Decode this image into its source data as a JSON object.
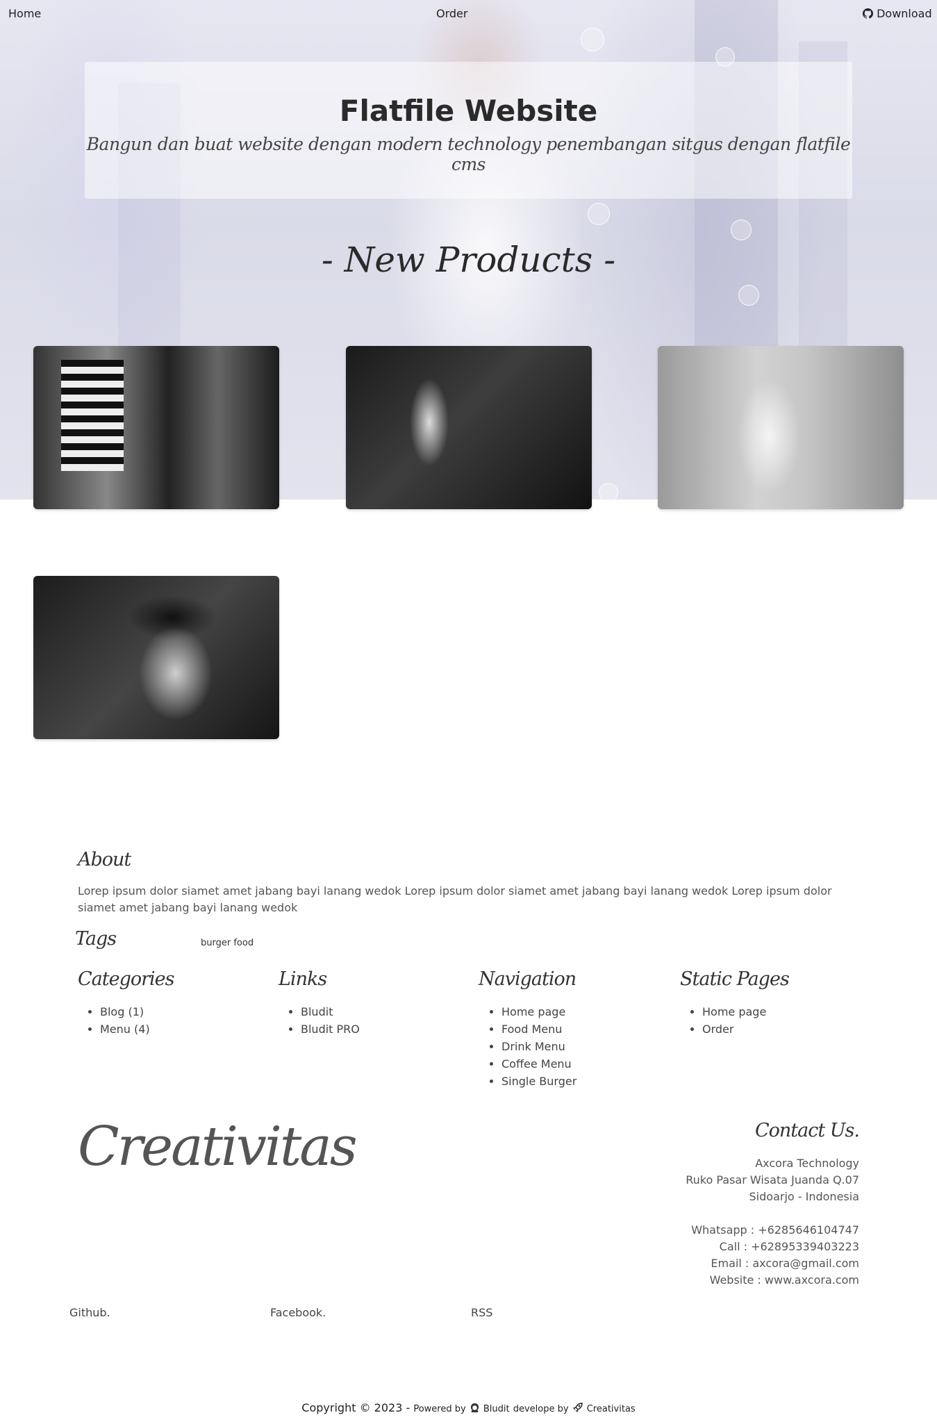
{
  "nav": {
    "home": "Home",
    "order": "Order",
    "download": "Download"
  },
  "banner": {
    "title": "Flatfile Website",
    "subtitle": "Bangun dan buat website dengan modern technology penembangan sitgus dengan flatfile cms"
  },
  "section": {
    "title": "- New Products -"
  },
  "products": [
    {
      "icon": "product-photo-striped-hoodie"
    },
    {
      "icon": "product-photo-dark-seat"
    },
    {
      "icon": "product-photo-sunglasses-street"
    },
    {
      "icon": "product-photo-black-cap"
    }
  ],
  "about": {
    "heading": "About",
    "text": "Lorep ipsum dolor siamet amet jabang bayi lanang wedok Lorep ipsum dolor siamet amet jabang bayi lanang wedok Lorep ipsum dolor siamet amet jabang bayi lanang wedok"
  },
  "tags": {
    "heading": "Tags",
    "items": [
      "burger food"
    ]
  },
  "categories": {
    "heading": "Categories",
    "items": [
      "Blog (1)",
      "Menu (4)"
    ]
  },
  "links": {
    "heading": "Links",
    "items": [
      "Bludit",
      "Bludit PRO"
    ]
  },
  "navigation": {
    "heading": "Navigation",
    "items": [
      "Home page",
      "Food Menu",
      "Drink Menu",
      "Coffee Menu",
      "Single Burger"
    ]
  },
  "static_pages": {
    "heading": "Static Pages",
    "items": [
      "Home page",
      "Order"
    ]
  },
  "brand": "Creativitas",
  "contact": {
    "heading": "Contact Us.",
    "company": "Axcora Technology",
    "address1": "Ruko Pasar Wisata Juanda Q.07",
    "address2": "Sidoarjo - Indonesia",
    "whatsapp": "Whatsapp : +6285646104747",
    "call": "Call : +62895339403223",
    "email": "Email : axcora@gmail.com",
    "website": "Website : www.axcora.com"
  },
  "social": {
    "github": "Github.",
    "facebook": "Facebook.",
    "rss": "RSS"
  },
  "footer": {
    "copyright": "Copyright © 2023 -",
    "powered_by": "Powered by",
    "bludit": "Bludit",
    "develope_by": "develope by",
    "creativitas": "Creativitas"
  },
  "colors": {
    "heading": "#2a2a2a",
    "text": "#555555",
    "banner_bg": "rgba(255,255,255,0.5)"
  }
}
